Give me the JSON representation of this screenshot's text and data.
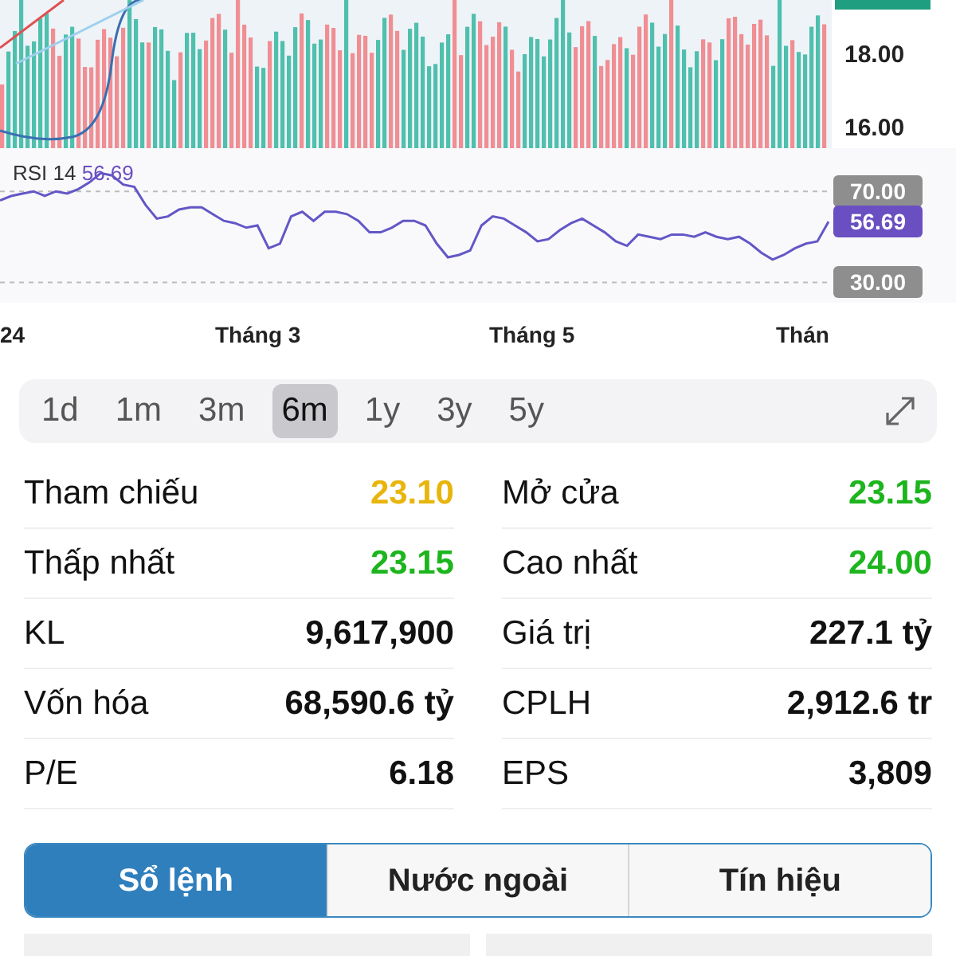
{
  "chart": {
    "price_axis": [
      "18.00",
      "16.00"
    ],
    "rsi": {
      "value": "56.69",
      "current": "56.69",
      "chart_data": {
        "type": "line",
        "ylim": [
          21,
          89
        ],
        "yticks": [
          {
            "value": 70,
            "label": "70.00"
          },
          {
            "value": 30,
            "label": "30.00"
          }
        ],
        "series": [
          {
            "name": "RSI 14",
            "color": "#6357c6",
            "values": [
              66,
              68,
              69,
              70,
              68,
              70,
              69,
              71,
              74,
              78,
              77,
              73,
              72,
              64,
              58,
              59,
              62,
              63,
              63,
              60,
              57,
              56,
              54,
              55,
              45,
              47,
              59,
              61,
              57,
              61,
              61,
              60,
              57,
              52,
              52,
              54,
              57,
              57,
              55,
              47,
              41,
              42,
              44,
              55,
              59,
              58,
              55,
              52,
              48,
              49,
              53,
              56,
              58,
              55,
              52,
              48,
              46,
              51,
              50,
              49,
              51,
              51,
              50,
              52,
              50,
              49,
              50,
              47,
              43,
              40,
              42,
              45,
              47,
              48,
              56.69
            ]
          }
        ]
      }
    },
    "x_labels": [
      "24",
      "Tháng 3",
      "Tháng 5",
      "Thán"
    ]
  },
  "periods": [
    {
      "label": "1d",
      "selected": false
    },
    {
      "label": "1m",
      "selected": false
    },
    {
      "label": "3m",
      "selected": false
    },
    {
      "label": "6m",
      "selected": true
    },
    {
      "label": "1y",
      "selected": false
    },
    {
      "label": "3y",
      "selected": false
    },
    {
      "label": "5y",
      "selected": false
    }
  ],
  "stats": [
    {
      "label": "Tham chiếu",
      "value": "23.10",
      "color": "#e8b50c"
    },
    {
      "label": "Mở cửa",
      "value": "23.15",
      "color": "#1db51d"
    },
    {
      "label": "Thấp nhất",
      "value": "23.15",
      "color": "#1db51d"
    },
    {
      "label": "Cao nhất",
      "value": "24.00",
      "color": "#1db51d"
    },
    {
      "label": "KL",
      "value": "9,617,900",
      "color": "#111111"
    },
    {
      "label": "Giá trị",
      "value": "227.1 tỷ",
      "color": "#111111"
    },
    {
      "label": "Vốn hóa",
      "value": "68,590.6 tỷ",
      "color": "#111111"
    },
    {
      "label": "CPLH",
      "value": "2,912.6 tr",
      "color": "#111111"
    },
    {
      "label": "P/E",
      "value": "6.18",
      "color": "#111111"
    },
    {
      "label": "EPS",
      "value": "3,809",
      "color": "#111111"
    }
  ],
  "tabs": [
    {
      "label": "Sổ lệnh",
      "selected": true
    },
    {
      "label": "Nước ngoài",
      "selected": false
    },
    {
      "label": "Tín hiệu",
      "selected": false
    }
  ]
}
